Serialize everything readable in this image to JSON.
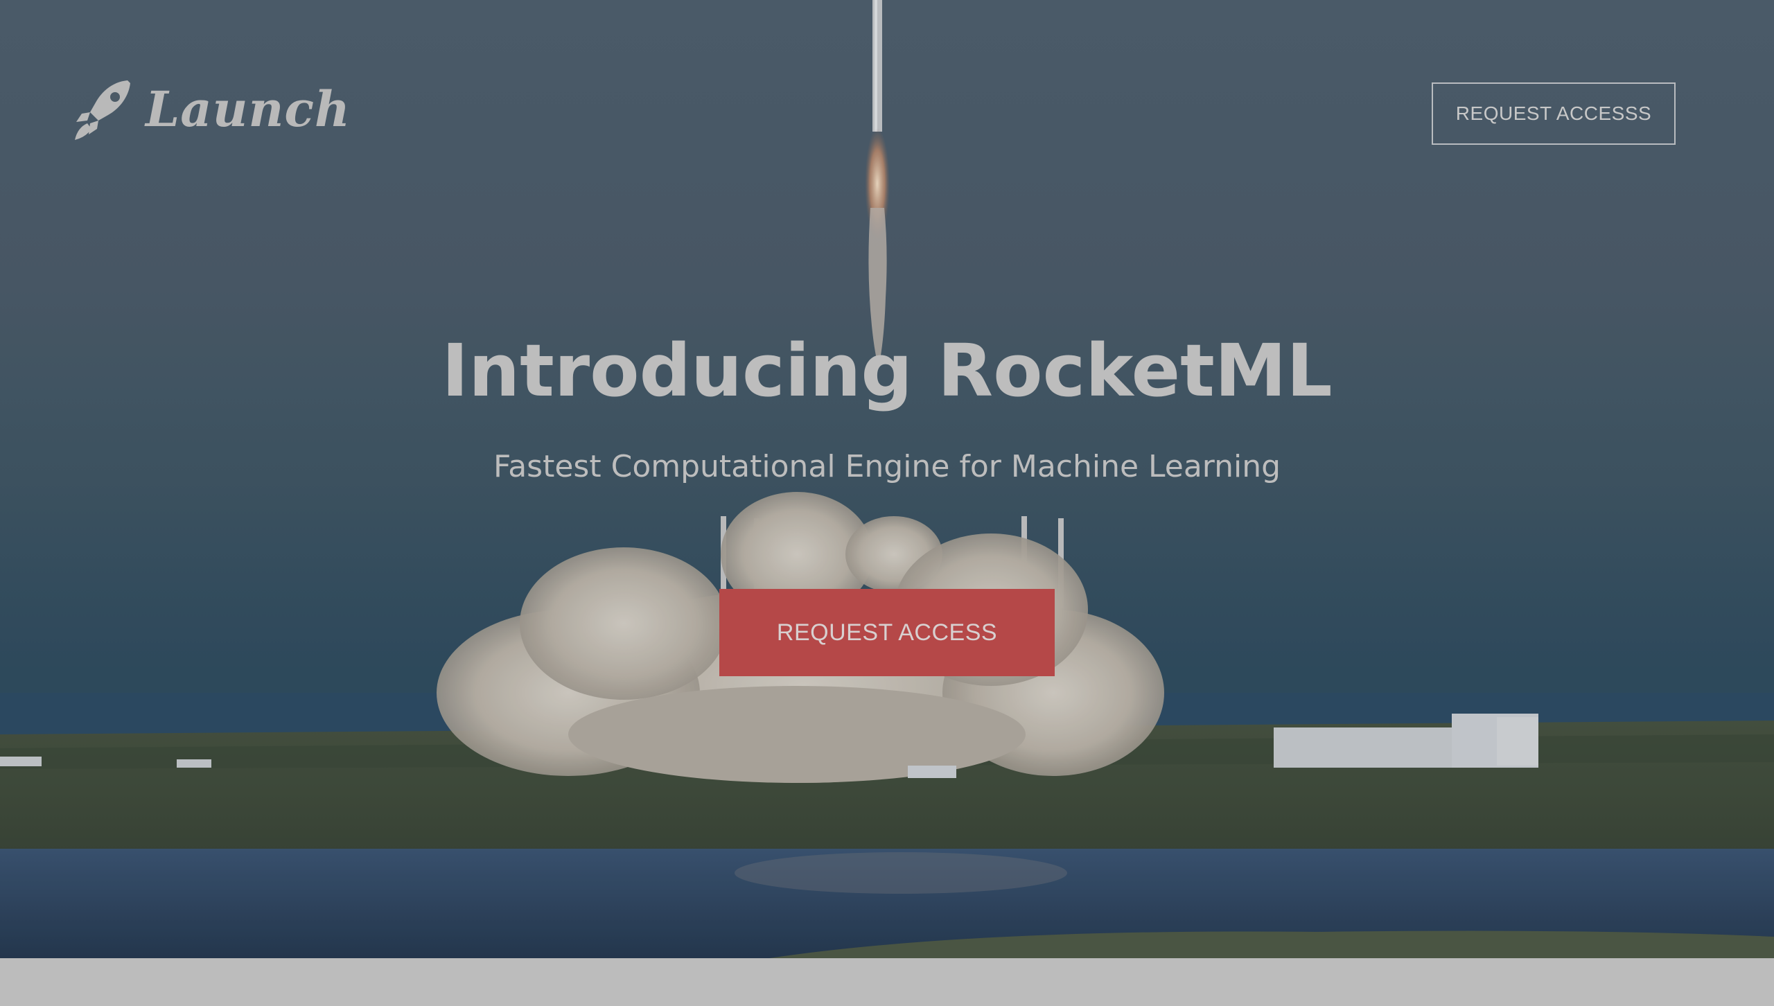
{
  "header": {
    "logo_text": "Launch",
    "logo_icon": "rocket-icon",
    "request_button_label": "REQUEST ACCESSS"
  },
  "hero": {
    "title": "Introducing RocketML",
    "subtitle": "Fastest Computational Engine for Machine Learning",
    "cta_label": "REQUEST ACCESS",
    "background_image": "rocket-launch-photo"
  },
  "colors": {
    "cta_background": "#b54848",
    "text": "#bdbdbd",
    "footer_strip": "#bcbcbc"
  }
}
